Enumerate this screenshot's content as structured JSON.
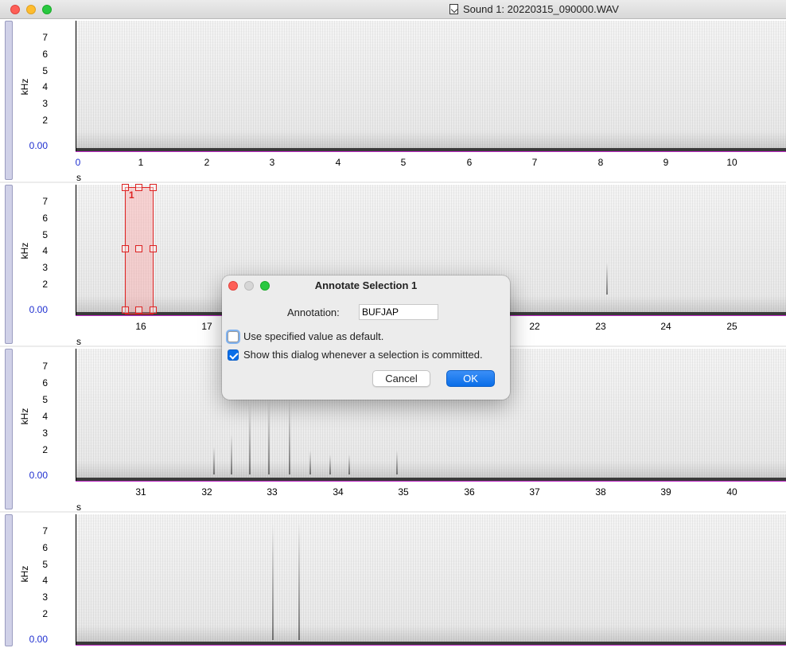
{
  "window": {
    "title": "Sound 1: 20220315_090000.WAV"
  },
  "axis": {
    "ylabel": "kHz",
    "xunit": "s",
    "yticks": [
      "7",
      "6",
      "5",
      "4",
      "3",
      "2",
      "0.00"
    ]
  },
  "panels": [
    {
      "xticks": [
        "0",
        "1",
        "2",
        "3",
        "4",
        "5",
        "6",
        "7",
        "8",
        "9",
        "10"
      ]
    },
    {
      "xticks": [
        "16",
        "17",
        "22",
        "23",
        "24",
        "25"
      ]
    },
    {
      "xticks": [
        "31",
        "32",
        "33",
        "34",
        "35",
        "36",
        "37",
        "38",
        "39",
        "40"
      ]
    },
    {
      "xticks": []
    }
  ],
  "selection": {
    "label": "1"
  },
  "dialog": {
    "title": "Annotate Selection 1",
    "annotation_label": "Annotation:",
    "annotation_value": "BUFJAP",
    "default_checkbox_label": "Use specified value as default.",
    "default_checkbox_checked": false,
    "show_checkbox_label": "Show this dialog whenever a selection is committed.",
    "show_checkbox_checked": true,
    "cancel_label": "Cancel",
    "ok_label": "OK"
  }
}
